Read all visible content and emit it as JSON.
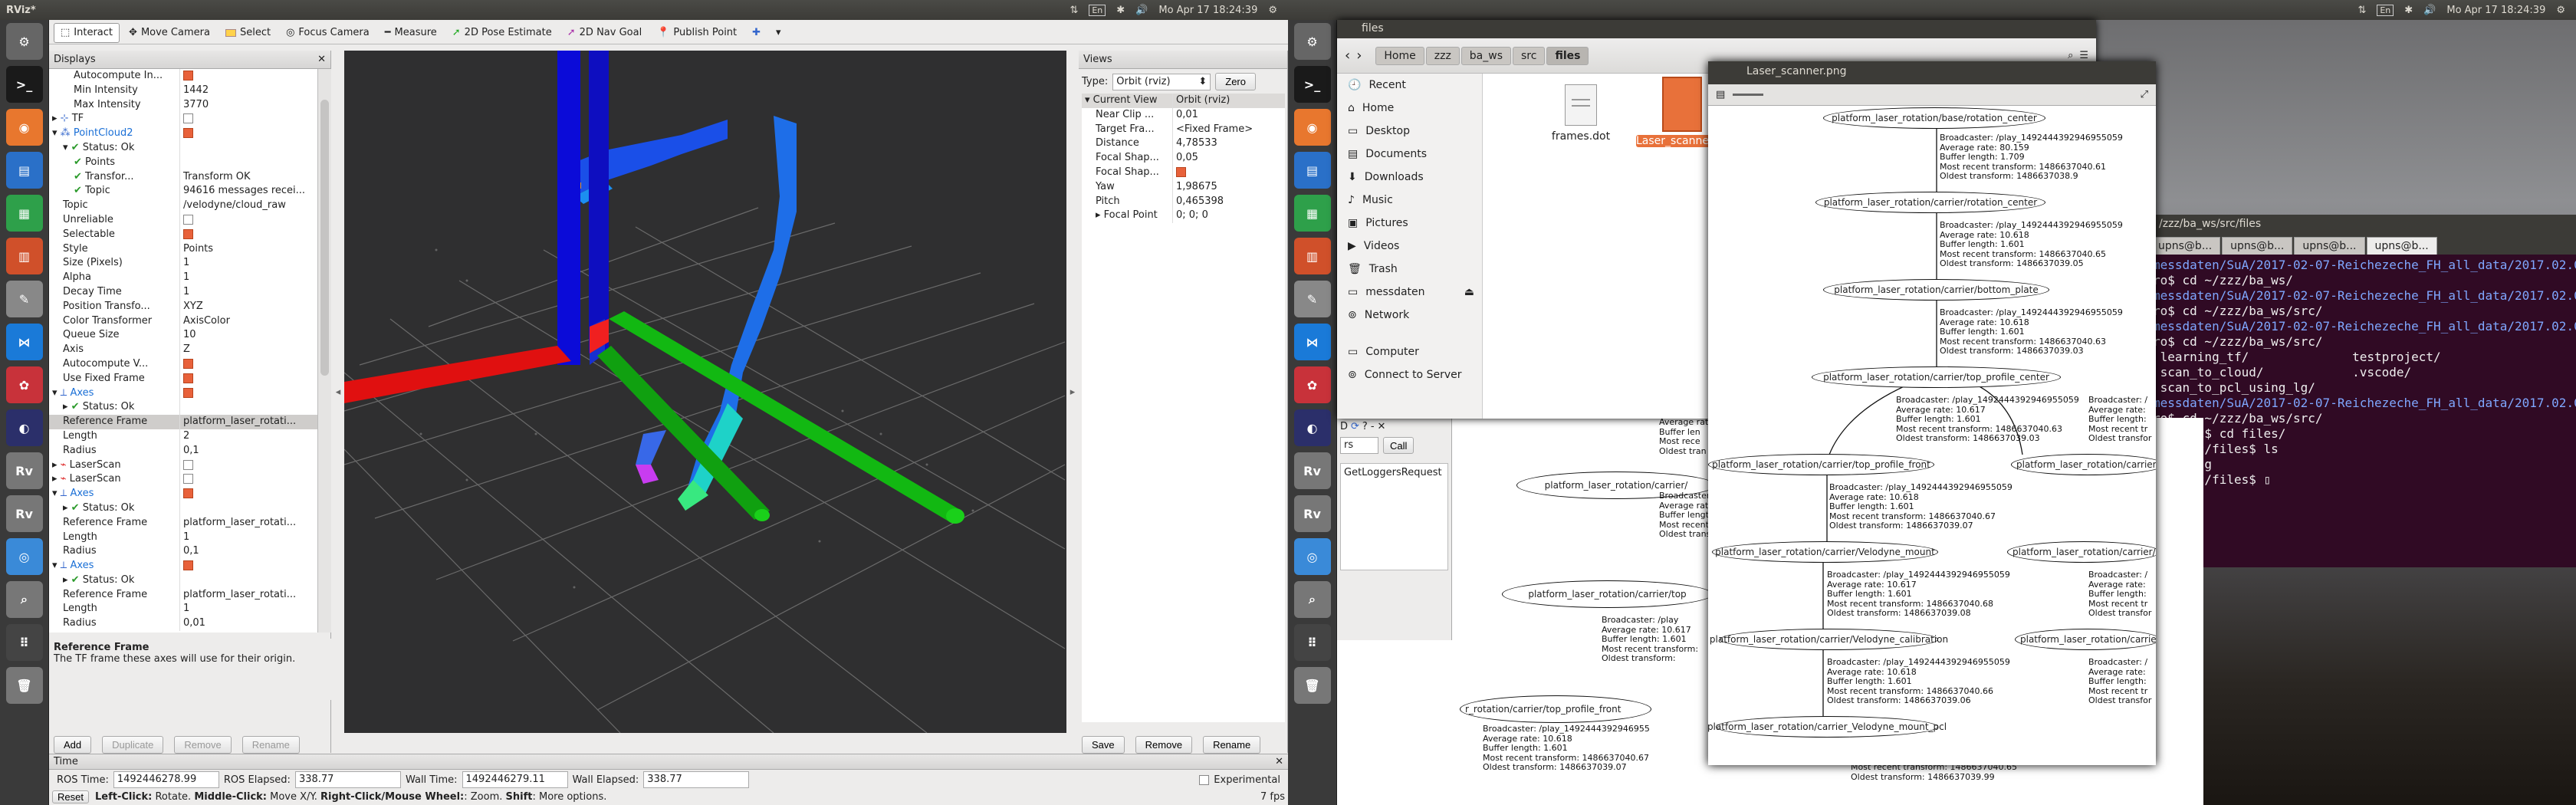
{
  "left_topbar": {
    "title": "RViz*",
    "time": "Mo Apr 17 18:24:39",
    "lang": "En"
  },
  "right_topbar": {
    "time": "Mo Apr 17 18:24:39",
    "lang": "En"
  },
  "toolbar": {
    "items": [
      "Interact",
      "Move Camera",
      "Select",
      "Focus Camera",
      "Measure",
      "2D Pose Estimate",
      "2D Nav Goal",
      "Publish Point"
    ]
  },
  "displays": {
    "title": "Displays",
    "rows": [
      {
        "k": "Autocompute In...",
        "v": "",
        "cb": "on",
        "ind": 2
      },
      {
        "k": "Min Intensity",
        "v": "1442",
        "ind": 2
      },
      {
        "k": "Max Intensity",
        "v": "3770",
        "ind": 2
      },
      {
        "k": "TF",
        "v": "",
        "cb": "off",
        "ind": 0,
        "arrow": "▸",
        "icon": "tf"
      },
      {
        "k": "PointCloud2",
        "v": "",
        "cb": "on",
        "ind": 0,
        "arrow": "▾",
        "icon": "pc",
        "blue": true
      },
      {
        "k": "Status: Ok",
        "v": "",
        "ind": 1,
        "arrow": "▾",
        "check": true
      },
      {
        "k": "Points",
        "v": "",
        "ind": 2,
        "check": true
      },
      {
        "k": "Transfor...",
        "v": "Transform OK",
        "ind": 2,
        "check": true
      },
      {
        "k": "Topic",
        "v": "94616 messages recei...",
        "ind": 2,
        "check": true
      },
      {
        "k": "Topic",
        "v": "/velodyne/cloud_raw",
        "ind": 1
      },
      {
        "k": "Unreliable",
        "v": "",
        "cb": "off",
        "ind": 1
      },
      {
        "k": "Selectable",
        "v": "",
        "cb": "on",
        "ind": 1
      },
      {
        "k": "Style",
        "v": "Points",
        "ind": 1
      },
      {
        "k": "Size (Pixels)",
        "v": "1",
        "ind": 1
      },
      {
        "k": "Alpha",
        "v": "1",
        "ind": 1
      },
      {
        "k": "Decay Time",
        "v": "1",
        "ind": 1
      },
      {
        "k": "Position Transfo...",
        "v": "XYZ",
        "ind": 1
      },
      {
        "k": "Color Transformer",
        "v": "AxisColor",
        "ind": 1
      },
      {
        "k": "Queue Size",
        "v": "10",
        "ind": 1
      },
      {
        "k": "Axis",
        "v": "Z",
        "ind": 1
      },
      {
        "k": "Autocompute V...",
        "v": "",
        "cb": "on",
        "ind": 1
      },
      {
        "k": "Use Fixed Frame",
        "v": "",
        "cb": "on",
        "ind": 1
      },
      {
        "k": "Axes",
        "v": "",
        "cb": "on",
        "ind": 0,
        "arrow": "▾",
        "icon": "axes",
        "blue": true
      },
      {
        "k": "Status: Ok",
        "v": "",
        "ind": 1,
        "arrow": "▸",
        "check": true
      },
      {
        "k": "Reference Frame",
        "v": "platform_laser_rotati...",
        "ind": 1,
        "sel": true
      },
      {
        "k": "Length",
        "v": "2",
        "ind": 1
      },
      {
        "k": "Radius",
        "v": "0,1",
        "ind": 1
      },
      {
        "k": "LaserScan",
        "v": "",
        "cb": "off",
        "ind": 0,
        "arrow": "▸",
        "icon": "ls"
      },
      {
        "k": "LaserScan",
        "v": "",
        "cb": "off",
        "ind": 0,
        "arrow": "▸",
        "icon": "ls"
      },
      {
        "k": "Axes",
        "v": "",
        "cb": "on",
        "ind": 0,
        "arrow": "▾",
        "icon": "axes",
        "blue": true
      },
      {
        "k": "Status: Ok",
        "v": "",
        "ind": 1,
        "arrow": "▸",
        "check": true
      },
      {
        "k": "Reference Frame",
        "v": "platform_laser_rotati...",
        "ind": 1
      },
      {
        "k": "Length",
        "v": "1",
        "ind": 1
      },
      {
        "k": "Radius",
        "v": "0,1",
        "ind": 1
      },
      {
        "k": "Axes",
        "v": "",
        "cb": "on",
        "ind": 0,
        "arrow": "▾",
        "icon": "axes",
        "blue": true
      },
      {
        "k": "Status: Ok",
        "v": "",
        "ind": 1,
        "arrow": "▸",
        "check": true
      },
      {
        "k": "Reference Frame",
        "v": "platform_laser_rotati...",
        "ind": 1
      },
      {
        "k": "Length",
        "v": "1",
        "ind": 1
      },
      {
        "k": "Radius",
        "v": "0,01",
        "ind": 1
      }
    ],
    "desc_title": "Reference Frame",
    "desc_text": "The TF frame these axes will use for their origin.",
    "buttons": [
      "Add",
      "Duplicate",
      "Remove",
      "Rename"
    ]
  },
  "views": {
    "title": "Views",
    "type_label": "Type:",
    "type_value": "Orbit (rviz)",
    "zero": "Zero",
    "rows": [
      {
        "k": "Current View",
        "v": "Orbit (rviz)",
        "head": true
      },
      {
        "k": "Near Clip ...",
        "v": "0,01"
      },
      {
        "k": "Target Fra...",
        "v": "<Fixed Frame>"
      },
      {
        "k": "Distance",
        "v": "4,78533"
      },
      {
        "k": "Focal Shap...",
        "v": "0,05"
      },
      {
        "k": "Focal Shap...",
        "v": "",
        "cb": "on"
      },
      {
        "k": "Yaw",
        "v": "1,98675"
      },
      {
        "k": "Pitch",
        "v": "0,465398"
      },
      {
        "k": "Focal Point",
        "v": "0; 0; 0",
        "arrow": "▸"
      }
    ],
    "buttons": [
      "Save",
      "Remove",
      "Rename"
    ]
  },
  "time": {
    "title": "Time",
    "ros_time_label": "ROS Time:",
    "ros_time": "1492446278.99",
    "ros_elapsed_label": "ROS Elapsed:",
    "ros_elapsed": "338.77",
    "wall_time_label": "Wall Time:",
    "wall_time": "1492446279.11",
    "wall_elapsed_label": "Wall Elapsed:",
    "wall_elapsed": "338.77",
    "experimental": "Experimental"
  },
  "status": {
    "reset": "Reset",
    "help_left": "Left-Click:",
    "help_left_t": " Rotate. ",
    "help_mid": "Middle-Click:",
    "help_mid_t": " Move X/Y. ",
    "help_right": "Right-Click/Mouse Wheel:",
    "help_right_t": ": Zoom. ",
    "help_shift": "Shift",
    "help_shift_t": ": More options.",
    "fps": "7 fps"
  },
  "files": {
    "title": "files",
    "crumbs": [
      "Home",
      "zzz",
      "ba_ws",
      "src",
      "files"
    ],
    "sidebar": [
      "Recent",
      "Home",
      "Desktop",
      "Documents",
      "Downloads",
      "Music",
      "Pictures",
      "Videos",
      "Trash",
      "messdaten",
      "Network",
      "Computer",
      "Connect to Server"
    ],
    "items": [
      {
        "name": "frames.dot"
      },
      {
        "name": "Laser_scanner.png"
      }
    ]
  },
  "imgviewer": {
    "title": "Laser_scanner.png"
  },
  "graph": {
    "nodes": [
      "platform_laser_rotation/base/rotation_center",
      "platform_laser_rotation/carrier/rotation_center",
      "platform_laser_rotation/carrier/bottom_plate",
      "platform_laser_rotation/carrier/top_profile_center",
      "platform_laser_rotation/carrier/top_profile_front",
      "platform_laser_rotation/carrier/top_p",
      "platform_laser_rotation/carrier/Velodyne_mount",
      "platform_laser_rotation/carrier/laser_m",
      "platform_laser_rotation/carrier/Velodyne_calibration",
      "platform_laser_rotation/carrier_lasi",
      "platform_laser_rotation/carrier_Velodyne_mount_pcl"
    ],
    "edges": [
      [
        "Broadcaster: /play_1492444392946955059",
        "Average rate: 80.159",
        "Buffer length: 1.709",
        "Most recent transform: 1486637040.61",
        "Oldest transform: 1486637038.9"
      ],
      [
        "Broadcaster: /play_1492444392946955059",
        "Average rate: 10.618",
        "Buffer length: 1.601",
        "Most recent transform: 1486637040.65",
        "Oldest transform: 1486637039.05"
      ],
      [
        "Broadcaster: /play_1492444392946955059",
        "Average rate: 10.618",
        "Buffer length: 1.601",
        "Most recent transform: 1486637040.63",
        "Oldest transform: 1486637039.03"
      ],
      [
        "Broadcaster: /play_1492444392946955059",
        "Average rate: 10.617",
        "Buffer length: 1.601",
        "Most recent transform: 1486637040.63",
        "Oldest transform: 1486637039.03"
      ],
      [
        "Broadcaster: /play_1492444392946955059",
        "Average rate: 10.618",
        "Buffer length: 1.601",
        "Most recent transform: 1486637040.67",
        "Oldest transform: 1486637039.07"
      ],
      [
        "Broadcaster: /play_1492444392946955059",
        "Average rate: 10.617",
        "Buffer length: 1.601",
        "Most recent transform: 1486637040.68",
        "Oldest transform: 1486637039.08"
      ],
      [
        "Broadcaster: /play_1492444392946955059",
        "Average rate: 10.618",
        "Buffer length: 1.601",
        "Most recent transform: 1486637040.66",
        "Oldest transform: 1486637039.06"
      ]
    ],
    "side_edge": [
      "Broadcaster: /",
      "Average rate:",
      "Buffer length:",
      "Most recent tr",
      "Oldest transfor"
    ]
  },
  "bg_graph": {
    "nodes": [
      "platform_laser_rotation/carrier/",
      "platform_laser_rotation/carrier/top",
      "r_rotation/carrier/top_profile_front"
    ],
    "edge1": [
      "Broadcaster: /play",
      "Average rate: 10.617",
      "Buffer length: 1.601",
      "Most recent transform:",
      "Oldest transform:"
    ],
    "edge2": [
      "Broadcaster: /play_1492444392946955",
      "Average rate: 10.618",
      "Buffer length: 1.601",
      "Most recent transform: 1486637040.67",
      "Oldest transform: 1486637039.07"
    ],
    "edge3": [
      "Most recent transform: 1486637040.65",
      "Oldest transform: 1486637039.99"
    ],
    "top_frag": [
      "Average rat",
      "Buffer len",
      "Most rece",
      "Oldest tran"
    ],
    "left_frag": [
      "Most rec",
      "Oldest tr"
    ]
  },
  "rqt": {
    "call": "Call",
    "request": "GetLoggersRequest",
    "rs": "rs"
  },
  "terminal": {
    "path_title": "/zzz/ba_ws/src/files",
    "tabs": [
      "upns@b...",
      "upns@b...",
      "upns@b...",
      "upns@b..."
    ],
    "lines": [
      "messdaten/SuA/2017-02-07-Reichezeche_FH_all_data/2017.02.09_",
      "ro$ cd ~/zzz/ba_ws/",
      "messdaten/SuA/2017-02-07-Reichezeche_FH_all_data/2017.02.09_",
      "ro$ cd ~/zzz/ba_ws/src/",
      "messdaten/SuA/2017-02-07-Reichezeche_FH_all_data/2017.02.09_",
      "ro$ cd ~/zzz/ba_ws/src/",
      " learning_tf/              testproject/",
      " scan_to_cloud/            .vscode/",
      " scan_to_pcl_using_lg/",
      "messdaten/SuA/2017-02-07-Reichezeche_FH_all_data/2017.02.09_",
      "ro$ cd ~/zzz/ba_ws/src/",
      "_ws/src$ cd files/",
      "_ws/src/files$ ls",
      "nner.png",
      "_ws/src/files$ "
    ],
    "colored": [
      0,
      2,
      4,
      9
    ]
  },
  "launcher_left": [
    "settings",
    "terminal",
    "firefox",
    "writer",
    "calc",
    "impress",
    "tools",
    "vscode",
    "ros",
    "eclipse",
    "rviz",
    "rviz",
    "chrome",
    "search",
    "apps",
    "trash"
  ],
  "colors": {
    "orange": "#e8613a",
    "purple": "#300a24",
    "blue": "#1a6fd6"
  }
}
